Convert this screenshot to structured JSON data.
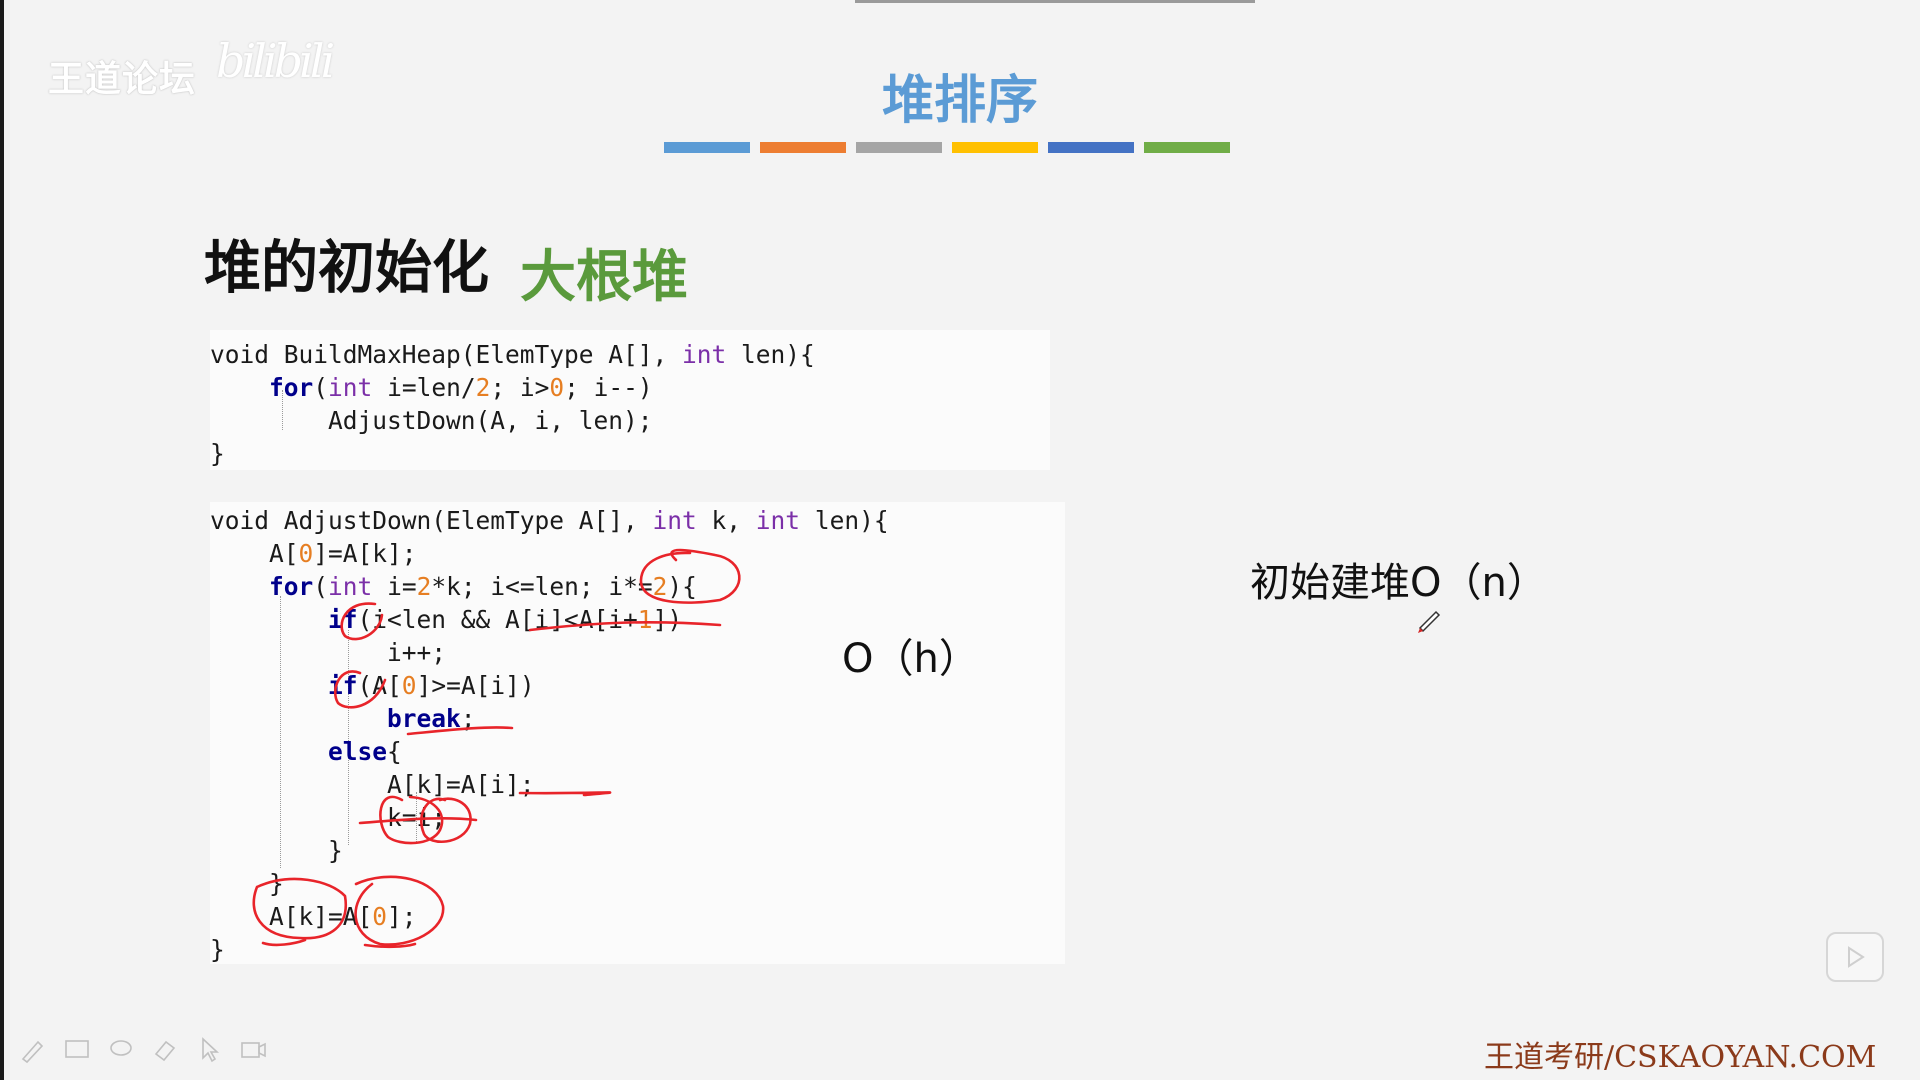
{
  "watermark": {
    "text": "王道论坛",
    "scrawl": "bilibili"
  },
  "slide": {
    "title": "堆排序",
    "color_bars": [
      "#5b9bd5",
      "#ed7d31",
      "#a5a5a5",
      "#ffc000",
      "#4472c4",
      "#70ad47"
    ],
    "section_heading": "堆的初始化",
    "section_sub": "大根堆"
  },
  "code_block_1": {
    "lines": [
      [
        [
          "t",
          "void BuildMaxHeap(ElemType A[], "
        ],
        [
          "kw",
          "int"
        ],
        [
          "t",
          " len){"
        ]
      ],
      [
        [
          "t",
          "    "
        ],
        [
          "kw2",
          "for"
        ],
        [
          "t",
          "("
        ],
        [
          "kw",
          "int"
        ],
        [
          "t",
          " i=len/"
        ],
        [
          "num",
          "2"
        ],
        [
          "t",
          "; i>"
        ],
        [
          "num",
          "0"
        ],
        [
          "t",
          "; i--)"
        ]
      ],
      [
        [
          "t",
          "        AdjustDown(A, i, len);"
        ]
      ],
      [
        [
          "t",
          "}"
        ]
      ]
    ]
  },
  "code_block_2": {
    "lines": [
      [
        [
          "t",
          "void AdjustDown(ElemType A[], "
        ],
        [
          "kw",
          "int"
        ],
        [
          "t",
          " k, "
        ],
        [
          "kw",
          "int"
        ],
        [
          "t",
          " len){"
        ]
      ],
      [
        [
          "t",
          "    A["
        ],
        [
          "num",
          "0"
        ],
        [
          "t",
          "]=A[k];"
        ]
      ],
      [
        [
          "t",
          "    "
        ],
        [
          "kw2",
          "for"
        ],
        [
          "t",
          "("
        ],
        [
          "kw",
          "int"
        ],
        [
          "t",
          " i="
        ],
        [
          "num",
          "2"
        ],
        [
          "t",
          "*k; i<=len; i*="
        ],
        [
          "num",
          "2"
        ],
        [
          "t",
          "){"
        ]
      ],
      [
        [
          "t",
          "        "
        ],
        [
          "kw2",
          "if"
        ],
        [
          "t",
          "(i<len && A[i]<A[i+"
        ],
        [
          "num",
          "1"
        ],
        [
          "t",
          "])"
        ]
      ],
      [
        [
          "t",
          "            i++;"
        ]
      ],
      [
        [
          "t",
          "        "
        ],
        [
          "kw2",
          "if"
        ],
        [
          "t",
          "(A["
        ],
        [
          "num",
          "0"
        ],
        [
          "t",
          "]>=A[i])"
        ]
      ],
      [
        [
          "t",
          "            "
        ],
        [
          "kw2",
          "break"
        ],
        [
          "t",
          ";"
        ]
      ],
      [
        [
          "t",
          "        "
        ],
        [
          "kw2",
          "else"
        ],
        [
          "t",
          "{"
        ]
      ],
      [
        [
          "t",
          "            A[k]=A[i];"
        ]
      ],
      [
        [
          "t",
          "            k=i;"
        ]
      ],
      [
        [
          "t",
          "        }"
        ]
      ],
      [
        [
          "t",
          "    }"
        ]
      ],
      [
        [
          "t",
          "    A[k]=A["
        ],
        [
          "num",
          "0"
        ],
        [
          "t",
          "];"
        ]
      ],
      [
        [
          "t",
          "}"
        ]
      ]
    ]
  },
  "annotations": {
    "complexity_h": "O（h）",
    "complexity_n": "初始建堆O（n）",
    "ink_color": "#e8242a"
  },
  "toolbar": {
    "tools": [
      "pen-icon",
      "whiteboard-icon",
      "lasso-icon",
      "eraser-icon",
      "pointer-icon",
      "camera-icon"
    ]
  },
  "player": {
    "play_icon": "play-icon"
  },
  "footer": {
    "brand": "王道考研/CSKAOYAN.COM"
  }
}
